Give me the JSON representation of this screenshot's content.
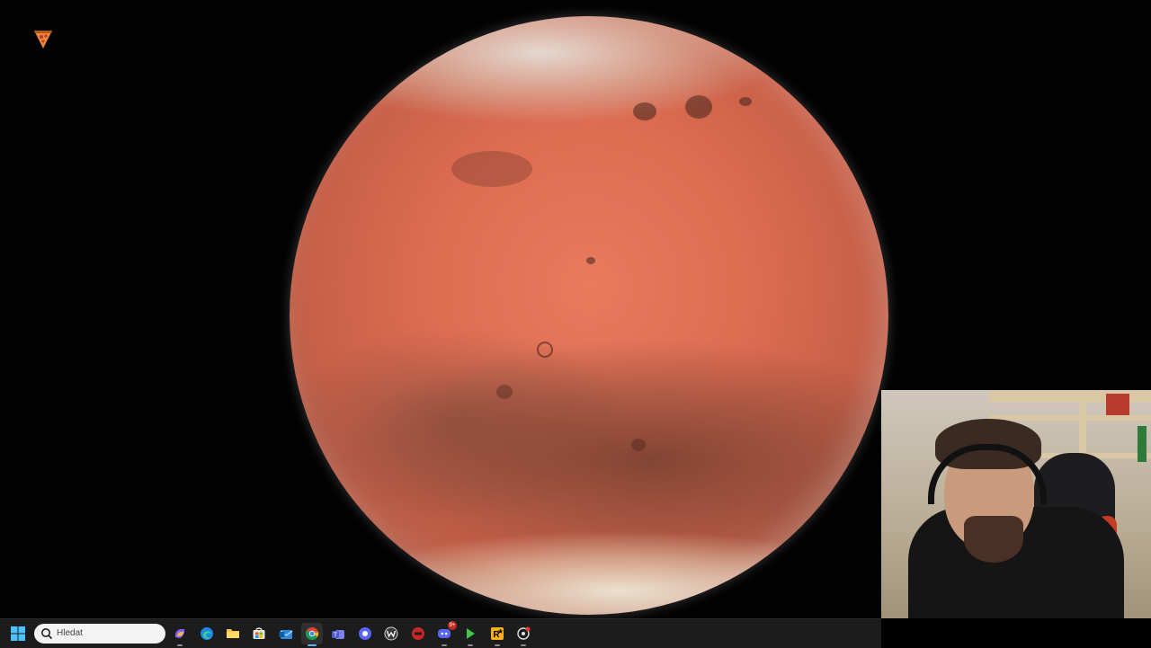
{
  "desktop": {
    "icons": [
      {
        "name": "pizza-slice-icon",
        "label": ""
      }
    ],
    "wallpaper": "mars-planet"
  },
  "taskbar": {
    "search": {
      "placeholder": "Hledat"
    },
    "items": [
      {
        "name": "start-button",
        "icon": "windows-logo-icon",
        "active": false
      },
      {
        "name": "copilot-button",
        "icon": "copilot-icon",
        "active": false
      },
      {
        "name": "edge-button",
        "icon": "edge-browser-icon",
        "active": false
      },
      {
        "name": "file-explorer-button",
        "icon": "folder-icon",
        "active": false
      },
      {
        "name": "store-button",
        "icon": "store-icon",
        "active": false
      },
      {
        "name": "outlook-button",
        "icon": "mail-icon",
        "active": false
      },
      {
        "name": "chrome-button",
        "icon": "chrome-icon",
        "active": true
      },
      {
        "name": "teams-button",
        "icon": "teams-icon",
        "active": false
      },
      {
        "name": "messenger-button",
        "icon": "chat-bubble-icon",
        "active": false
      },
      {
        "name": "app-w-button",
        "icon": "w-logo-icon",
        "active": false
      },
      {
        "name": "app-red-button",
        "icon": "red-logo-icon",
        "active": false
      },
      {
        "name": "discord-button",
        "icon": "discord-icon",
        "active": false,
        "badge": "9+"
      },
      {
        "name": "media-play-button",
        "icon": "play-icon",
        "active": false
      },
      {
        "name": "rockstar-button",
        "icon": "rockstar-icon",
        "active": false
      },
      {
        "name": "settings-app-button",
        "icon": "gear-circle-icon",
        "active": false
      }
    ]
  },
  "colors": {
    "taskbar_bg": "#1c1c1c",
    "accent": "#5fb2f2",
    "mars": "#de6d52"
  }
}
